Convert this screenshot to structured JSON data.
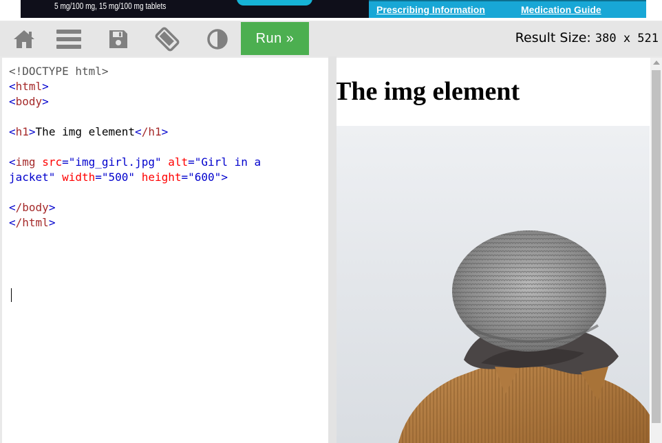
{
  "ad": {
    "dosage_text": "5 mg/100 mg, 15 mg/100 mg tablets",
    "links": [
      "Prescribing Information",
      "Medication Guide"
    ]
  },
  "toolbar": {
    "icons": [
      "home-icon",
      "menu-icon",
      "save-icon",
      "rotate-icon",
      "contrast-icon"
    ],
    "run_label": "Run »",
    "result_size_label": "Result Size:",
    "result_size_value": "380 x 521"
  },
  "editor": {
    "lines": {
      "doctype": "<!DOCTYPE html>",
      "html_open": "html",
      "body_open": "body",
      "h1_text": "The img element",
      "img_src": "\"img_girl.jpg\"",
      "img_alt": "\"Girl in a\njacket\"",
      "img_width": "\"500\"",
      "img_height": "\"600\"",
      "body_close": "/body",
      "html_close": "/html"
    }
  },
  "result": {
    "heading": "The img element",
    "image_alt": "Girl in a jacket"
  },
  "colors": {
    "run_button": "#4caf50",
    "tag": "#a52a2a",
    "attribute": "#ff0000",
    "value": "#0000cd",
    "ad_blue": "#18a7d6"
  }
}
